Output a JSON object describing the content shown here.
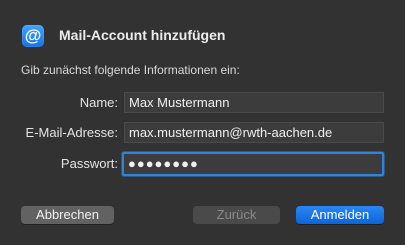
{
  "dialog": {
    "icon": "at-sign-icon",
    "icon_glyph": "@",
    "title": "Mail-Account hinzufügen",
    "subtitle": "Gib zunächst folgende Informationen ein:"
  },
  "form": {
    "name": {
      "label": "Name:",
      "value": "Max Mustermann"
    },
    "email": {
      "label": "E-Mail-Adresse:",
      "value": "max.mustermann@rwth-aachen.de"
    },
    "password": {
      "label": "Passwort:",
      "masked_value": "●●●●●●●●"
    }
  },
  "buttons": {
    "cancel_label": "Abbrechen",
    "back_label": "Zurück",
    "sign_in_label": "Anmelden"
  },
  "colors": {
    "accent": "#2f83d8",
    "primary_button": "#0b65d9",
    "background": "#323232"
  }
}
